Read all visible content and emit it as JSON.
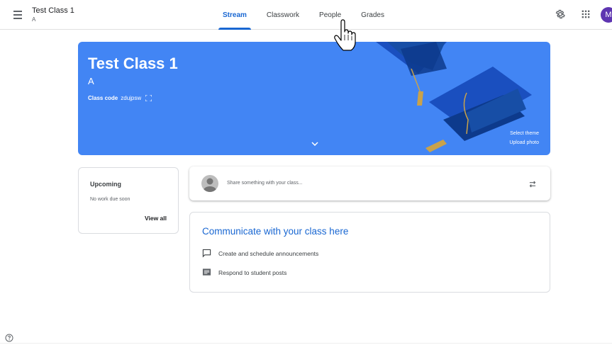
{
  "header": {
    "class_title": "Test Class 1",
    "class_section": "A",
    "tabs": [
      {
        "label": "Stream",
        "active": true
      },
      {
        "label": "Classwork",
        "active": false
      },
      {
        "label": "People",
        "active": false
      },
      {
        "label": "Grades",
        "active": false
      }
    ],
    "user_initial": "M",
    "icons": [
      "menu-icon",
      "gear-icon",
      "apps-icon"
    ]
  },
  "banner": {
    "title": "Test Class 1",
    "section": "A",
    "class_code_label": "Class code",
    "class_code": "zdujpsw",
    "select_theme": "Select theme",
    "upload_photo": "Upload photo",
    "color": "#4285f4"
  },
  "upcoming": {
    "title": "Upcoming",
    "subtitle": "No work due soon",
    "view_all": "View all"
  },
  "share": {
    "placeholder": "Share something with your class..."
  },
  "communicate": {
    "title": "Communicate with your class here",
    "items": [
      {
        "label": "Create and schedule announcements",
        "icon": "comment-icon"
      },
      {
        "label": "Respond to student posts",
        "icon": "forum-icon"
      }
    ]
  },
  "colors": {
    "accent": "#1967d2",
    "avatar": "#5e35b1"
  }
}
